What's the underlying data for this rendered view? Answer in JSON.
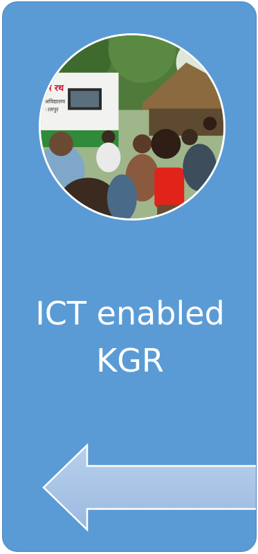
{
  "card": {
    "background_color": "#5b9bd5",
    "title_line_1": "ICT enabled",
    "title_line_2": "KGR"
  },
  "photo": {
    "banner_text": "म रथ",
    "sub_text_1": "अविद्यालय",
    "sub_text_2": "ालपुर"
  },
  "arrow": {
    "icon": "arrow-left-icon",
    "fill_color": "#a9c4e6",
    "stroke_color": "#ffffff"
  }
}
